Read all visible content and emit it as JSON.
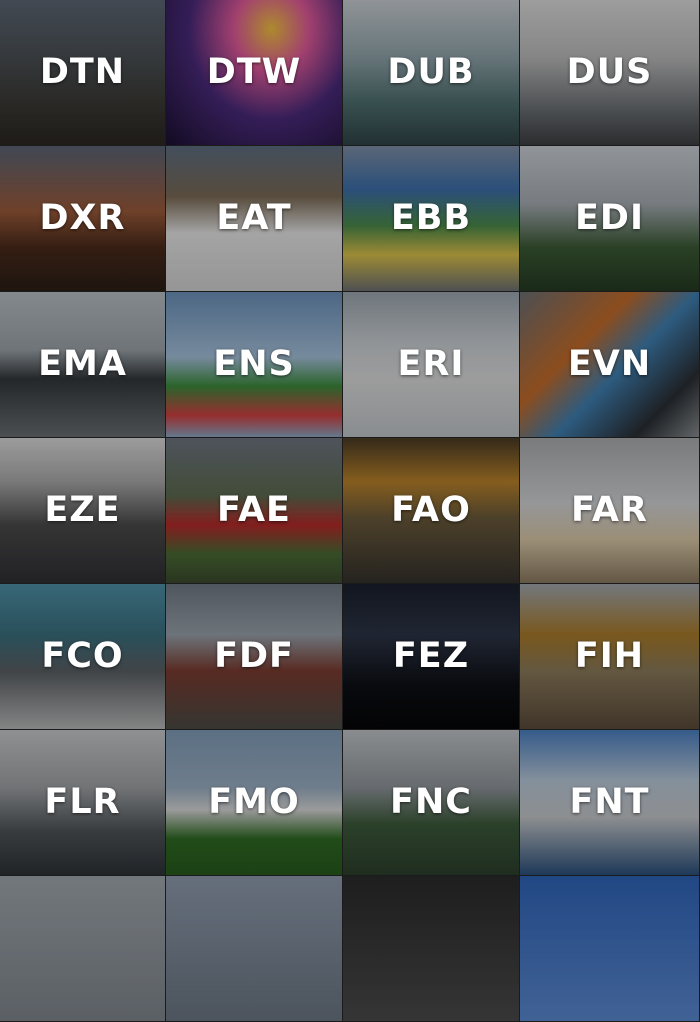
{
  "tiles": [
    {
      "code": "DTN",
      "bg": "linear-gradient(180deg,#5b6673 0%,#4a4f53 40%,#3b3a36 70%,#2a2622 100%)"
    },
    {
      "code": "DTW",
      "bg": "radial-gradient(ellipse at 60% 20%,#f0c040 0%,#e05a9a 25%,#4a2a7a 55%,#1a1030 100%)"
    },
    {
      "code": "DUB",
      "bg": "linear-gradient(180deg,#c8cdd2 0%,#8ea2a8 40%,#4f6f70 70%,#2f4446 100%)"
    },
    {
      "code": "DUS",
      "bg": "linear-gradient(180deg,#dadada 0%,#b9b9b9 40%,#6b6f73 75%,#3c3e41 100%)"
    },
    {
      "code": "DXR",
      "bg": "linear-gradient(180deg,#5a6475 0%,#9a5a3a 45%,#4a2a1a 70%,#2a1e16 100%)"
    },
    {
      "code": "EAT",
      "bg": "linear-gradient(180deg,#5d6c80 0%,#7a6a55 35%,#e4e4e4 60%,#cfcfcf 100%)"
    },
    {
      "code": "EBB",
      "bg": "linear-gradient(180deg,#7d8ea6 0%,#3c6ea8 30%,#4c8a4a 55%,#d9c04a 75%,#6d7072 100%)"
    },
    {
      "code": "EDI",
      "bg": "linear-gradient(180deg,#c9ced3 0%,#a5abb1 40%,#3b5a35 70%,#253a22 100%)"
    },
    {
      "code": "EMA",
      "bg": "linear-gradient(180deg,#b7bec4 0%,#9aa2a8 40%,#33373a 60%,#6a6e72 100%)"
    },
    {
      "code": "ENS",
      "bg": "linear-gradient(180deg,#6a8fb8 0%,#a4c0da 45%,#3c8a3c 65%,#d04040 85%,#8aa7c4 100%)"
    },
    {
      "code": "ERI",
      "bg": "linear-gradient(180deg,#9aa4ad 0%,#c9ced2 35%,#d9d9d9 60%,#bfc4c8 100%)"
    },
    {
      "code": "EVN",
      "bg": "linear-gradient(135deg,#6b6f73 0%,#c26b2a 35%,#3f7fb0 55%,#2a2e33 80%,#8a8e92 100%)"
    },
    {
      "code": "EZE",
      "bg": "linear-gradient(180deg,#d8d8d8 0%,#a9a9a9 30%,#4a4a4a 60%,#2f2f33 100%)"
    },
    {
      "code": "FAE",
      "bg": "linear-gradient(180deg,#6d7480 0%,#5d6a4f 40%,#b52a2a 60%,#496b35 80%,#3c4a2e 100%)"
    },
    {
      "code": "FAO",
      "bg": "linear-gradient(180deg,#4a3a25 0%,#b9822a 30%,#6a5a3a 55%,#34312d 100%)"
    },
    {
      "code": "FAR",
      "bg": "linear-gradient(180deg,#a9abad 0%,#cfd1d3 45%,#d8c6a6 70%,#8a7a60 100%)"
    },
    {
      "code": "FCO",
      "bg": "linear-gradient(180deg,#4e8fa6 0%,#3a6f7e 35%,#5a5f63 60%,#b8b8b8 100%)"
    },
    {
      "code": "FDF",
      "bg": "linear-gradient(180deg,#6f7882 0%,#97a1aa 35%,#7a3b30 60%,#4b4b45 100%)"
    },
    {
      "code": "FEZ",
      "bg": "linear-gradient(180deg,#1a1f2c 0%,#2c3446 35%,#0d0f14 70%,#050507 100%)"
    },
    {
      "code": "FIH",
      "bg": "linear-gradient(180deg,#a0a7ad 0%,#a87a2a 35%,#8a7a5a 60%,#5a4a3a 100%)"
    },
    {
      "code": "FLR",
      "bg": "linear-gradient(180deg,#c6c8ca 0%,#9da0a3 40%,#4d5357 70%,#2e3236 100%)"
    },
    {
      "code": "FMO",
      "bg": "linear-gradient(180deg,#7f9bb6 0%,#9aaec2 40%,#d7d7d7 55%,#2f6a23 75%,#275a1d 100%)"
    },
    {
      "code": "FNC",
      "bg": "linear-gradient(180deg,#bfc3c6 0%,#8e9499 40%,#3c5a3a 65%,#2c3f2d 100%)"
    },
    {
      "code": "FNT",
      "bg": "linear-gradient(180deg,#4b7fc0 0%,#b8c8d8 35%,#c4c6c9 60%,#2a4f7a 100%)"
    },
    {
      "code": "",
      "bg": "linear-gradient(180deg,#9fa6ad 0%,#7e858c 100%)",
      "partial": true
    },
    {
      "code": "",
      "bg": "linear-gradient(180deg,#8d9aab 0%,#6a7582 100%)",
      "partial": true
    },
    {
      "code": "",
      "bg": "linear-gradient(180deg,#2a2a2a 0%,#4a4a4a 100%)",
      "partial": true
    },
    {
      "code": "",
      "bg": "linear-gradient(180deg,#2f64b8 0%,#5a88cf 100%)",
      "partial": true
    }
  ]
}
